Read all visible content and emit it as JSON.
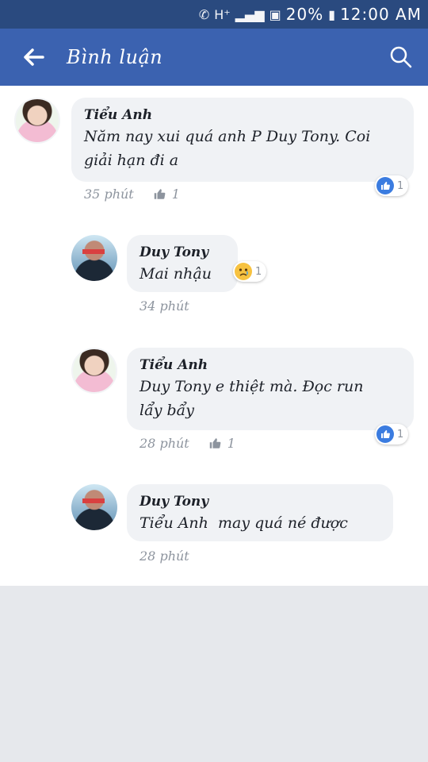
{
  "status_bar": {
    "battery": "20%",
    "time": "12:00 AM"
  },
  "header": {
    "title": "Bình luận"
  },
  "comments": [
    {
      "author": "Tiểu Anh",
      "text_line1": "Năm nay xui quá anh P Duy Tony. Coi",
      "text_line2": "giải hạn đi a",
      "time": "35 phút",
      "likes": "1",
      "reaction_count": "1"
    },
    {
      "author": "Duy Tony",
      "text_line1": "Mai nhậu",
      "time": "34 phút",
      "reaction_count": "1"
    },
    {
      "author": "Tiểu Anh",
      "text_line1": "Duy Tony e thiệt mà. Đọc run",
      "text_line2": "lẩy bẩy",
      "time": "28 phút",
      "likes": "1",
      "reaction_count": "1"
    },
    {
      "author": "Duy Tony",
      "text_line1": "Tiểu Anh  may quá né được",
      "time": "28 phút"
    }
  ],
  "colors": {
    "status_bar": "#2a4a7f",
    "app_bar": "#3b62b0",
    "bubble": "#f0f2f5",
    "like_blue": "#3b7ce0",
    "meta_gray": "#8d949e"
  }
}
